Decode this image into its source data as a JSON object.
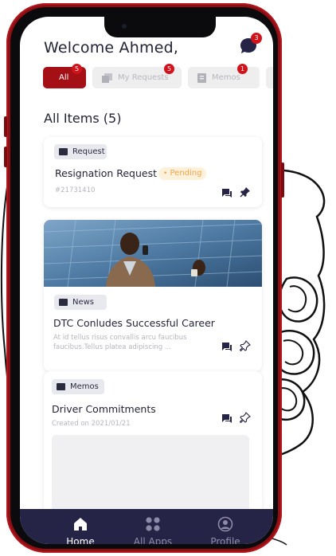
{
  "header": {
    "greeting": "Welcome Ahmed,",
    "chat_badge": "3"
  },
  "tabs": [
    {
      "label": "All",
      "badge": "5"
    },
    {
      "label": "My Requests",
      "badge": "5"
    },
    {
      "label": "Memos",
      "badge": "1"
    }
  ],
  "section": {
    "title": "All Items (5)"
  },
  "cards": [
    {
      "chip": "Request",
      "title": "Resignation Request",
      "status": "Pending",
      "id": "#21731410"
    },
    {
      "chip": "News",
      "title": "DTC Conludes Successful Career",
      "excerpt": "At id tellus risus convallis arcu faucibus faucibus.Tellus platea adipiscing ..."
    },
    {
      "chip": "Memos",
      "title": "Driver Commitments",
      "date": "Created on 2021/01/21"
    }
  ],
  "bottom_nav": [
    {
      "label": "Home",
      "icon": "home-icon",
      "active": true
    },
    {
      "label": "All Apps",
      "icon": "grid-icon",
      "active": false
    },
    {
      "label": "Profile",
      "icon": "user-icon",
      "active": false
    }
  ],
  "colors": {
    "accent": "#a41015",
    "badge": "#d3131b",
    "nav_bg": "#262446",
    "pending": "#f2a44a"
  }
}
